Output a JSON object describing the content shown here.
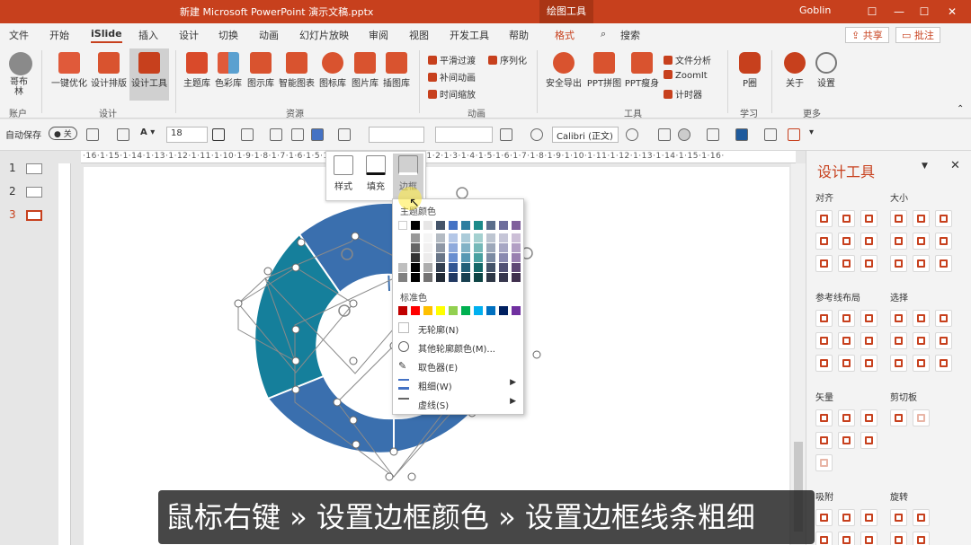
{
  "window": {
    "title": "新建 Microsoft PowerPoint 演示文稿.pptx",
    "context_title": "绘图工具",
    "user": "Goblin",
    "minimize": "—",
    "restore": "▢",
    "maximize": "☐",
    "close": "✕"
  },
  "tabs": [
    "文件",
    "开始",
    "iSlide",
    "插入",
    "设计",
    "切换",
    "动画",
    "幻灯片放映",
    "审阅",
    "视图",
    "开发工具",
    "帮助",
    "格式"
  ],
  "search_label": "搜索",
  "share_label": "共享",
  "comment_label": "批注",
  "ribbon": {
    "account": {
      "label": "哥布林",
      "group": "账户"
    },
    "design": {
      "items": [
        "一键优化",
        "设计排版",
        "设计工具"
      ],
      "group": "设计"
    },
    "resources": {
      "items": [
        "主题库",
        "色彩库",
        "图示库",
        "智能图表",
        "图标库",
        "图片库",
        "插图库"
      ],
      "group": "资源"
    },
    "animation": {
      "items": [
        "平滑过渡",
        "序列化",
        "补间动画",
        "时间缩放"
      ],
      "group": "动画"
    },
    "tools": {
      "items": [
        "安全导出",
        "PPT拼图",
        "PPT瘦身",
        "文件分析",
        "ZoomIt",
        "计时器"
      ],
      "group": "工具"
    },
    "learn": {
      "items": [
        "P圈"
      ],
      "group": "学习"
    },
    "more": {
      "items": [
        "关于",
        "设置"
      ],
      "group": "更多"
    }
  },
  "qat": {
    "autosave_label": "自动保存",
    "autosave_state": "关",
    "font_size": "18",
    "font_name": "Calibri (正文)"
  },
  "slides": [
    {
      "num": "1"
    },
    {
      "num": "2"
    },
    {
      "num": "3"
    }
  ],
  "ruler_text": "·16·1·15·1·14·1·13·1·12·1·11·1·10·1·9·1·8·1·7·1·6·1·5·1·4·1·3·1·2·1·1·1·0·1·1·1·2·1·3·1·4·1·5·1·6·1·7·1·8·1·9·1·10·1·11·1·12·1·13·1·14·1·15·1·16·",
  "mini_toolbar": {
    "style": "样式",
    "fill": "填充",
    "outline": "边框"
  },
  "dropdown": {
    "theme_header": "主题颜色",
    "standard_header": "标准色",
    "no_outline": "无轮廓(N)",
    "more_colors": "其他轮廓颜色(M)...",
    "eyedropper": "取色器(E)",
    "weight": "粗细(W)",
    "dashes": "虚线(S)",
    "theme_top": [
      "#ffffff",
      "#000000",
      "#e7e6e6",
      "#44546a",
      "#4472c4",
      "#2e7ea0",
      "#1b8a8a",
      "#5b6e8c",
      "#6d6d9c",
      "#7f5f9c"
    ],
    "standard_colors": [
      "#c00000",
      "#ff0000",
      "#ffc000",
      "#ffff00",
      "#92d050",
      "#00b050",
      "#00b0f0",
      "#0070c0",
      "#002060",
      "#7030a0"
    ]
  },
  "pane": {
    "title": "设计工具",
    "sections": [
      "对齐",
      "大小",
      "参考线布局",
      "选择",
      "矢量",
      "剪切板",
      "吸附",
      "旋转"
    ]
  },
  "subtitle": "鼠标右键 » 设置边框颜色 » 设置边框线条粗细",
  "colors": {
    "accent": "#c7401d",
    "shape_blue": "#3a6fae",
    "shape_teal": "#157f9b"
  }
}
